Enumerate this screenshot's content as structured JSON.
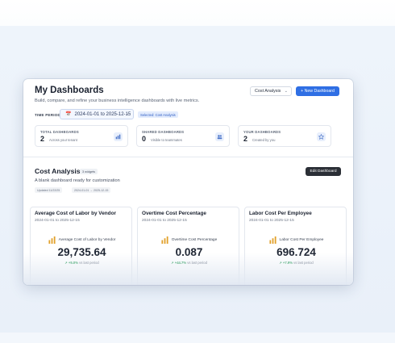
{
  "header": {
    "title": "My Dashboards",
    "subtitle": "Build, compare, and refine your business intelligence dashboards with live metrics.",
    "select_value": "Cost Analysis",
    "new_button": "+ New Dashboard"
  },
  "time_period": {
    "label": "TIME PERIOD",
    "range": "2024-01-01 to 2025-12-15",
    "selected_badge": "Selected: Cost Analysis"
  },
  "stats": [
    {
      "label": "TOTAL DASHBOARDS",
      "value": "2",
      "sub": "Across your tenant"
    },
    {
      "label": "SHARED DASHBOARDS",
      "value": "0",
      "sub": "Visible to teammates"
    },
    {
      "label": "YOUR DASHBOARDS",
      "value": "2",
      "sub": "Created by you"
    }
  ],
  "section": {
    "title": "Cost Analysis",
    "count_badge": "3 widgets",
    "description": "A blank dashboard ready for customization",
    "tags": [
      "Updated 11/22/25",
      "2024-01-01 → 2025-12-15"
    ],
    "edit_button": "Edit Dashboard"
  },
  "widgets": [
    {
      "title": "Average Cost of Labor by Vendor",
      "range": "2024-01-01 to 2025-12-15",
      "metric": "Average Cost of Labor by Vendor",
      "value": "29,735.64",
      "change": "+5.0%",
      "change_note": "vs last period"
    },
    {
      "title": "Overtime Cost Percentage",
      "range": "2024-01-01 to 2025-12-15",
      "metric": "Overtime Cost Percentage",
      "value": "0.087",
      "change": "+44.7%",
      "change_note": "vs last period"
    },
    {
      "title": "Labor Cost Per Employee",
      "range": "2024-01-01 to 2025-12-15",
      "metric": "Labor Cost Per Employee",
      "value": "696.724",
      "change": "+7.9%",
      "change_note": "vs last period"
    }
  ],
  "colors": {
    "accent": "#2f6fe4",
    "positive": "#2a9d5a",
    "metric_icon": "#e2a12b"
  }
}
